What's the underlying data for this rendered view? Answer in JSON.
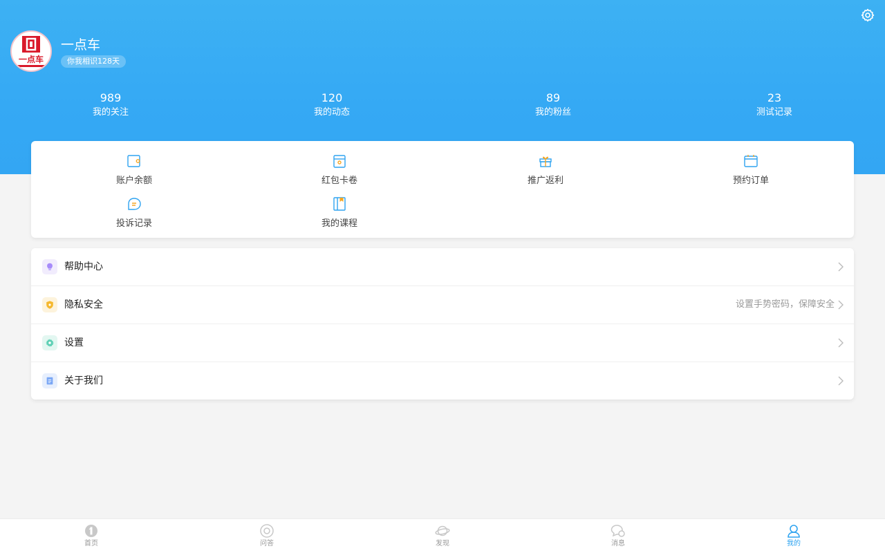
{
  "profile": {
    "username": "一点车",
    "days_badge": "你我相识128天",
    "logo_text": "一点车"
  },
  "stats": [
    {
      "value": "989",
      "label": "我的关注"
    },
    {
      "value": "120",
      "label": "我的动态"
    },
    {
      "value": "89",
      "label": "我的粉丝"
    },
    {
      "value": "23",
      "label": "测试记录"
    }
  ],
  "grid": [
    {
      "label": "账户余额",
      "icon": "wallet-icon"
    },
    {
      "label": "红包卡卷",
      "icon": "red-packet-icon"
    },
    {
      "label": "推广返利",
      "icon": "gift-icon"
    },
    {
      "label": "预约订单",
      "icon": "calendar-icon"
    },
    {
      "label": "投诉记录",
      "icon": "complaint-icon"
    },
    {
      "label": "我的课程",
      "icon": "course-book-icon"
    }
  ],
  "menu": [
    {
      "label": "帮助中心",
      "hint": "",
      "icon": "lightbulb-icon",
      "color": "#a78bfa"
    },
    {
      "label": "隐私安全",
      "hint": "设置手势密码，保障安全",
      "icon": "shield-icon",
      "color": "#f5b82e"
    },
    {
      "label": "设置",
      "hint": "",
      "icon": "gear-icon",
      "color": "#5fd0b5"
    },
    {
      "label": "关于我们",
      "hint": "",
      "icon": "document-icon",
      "color": "#7aa7f5"
    }
  ],
  "tabbar": [
    {
      "label": "首页",
      "icon": "home-icon",
      "active": false
    },
    {
      "label": "问答",
      "icon": "qa-icon",
      "active": false
    },
    {
      "label": "发现",
      "icon": "discover-icon",
      "active": false
    },
    {
      "label": "消息",
      "icon": "message-icon",
      "active": false
    },
    {
      "label": "我的",
      "icon": "profile-icon",
      "active": true
    }
  ],
  "colors": {
    "header": "#3db1f3",
    "accent": "#2ea3f0",
    "background": "#f4f4f4"
  }
}
